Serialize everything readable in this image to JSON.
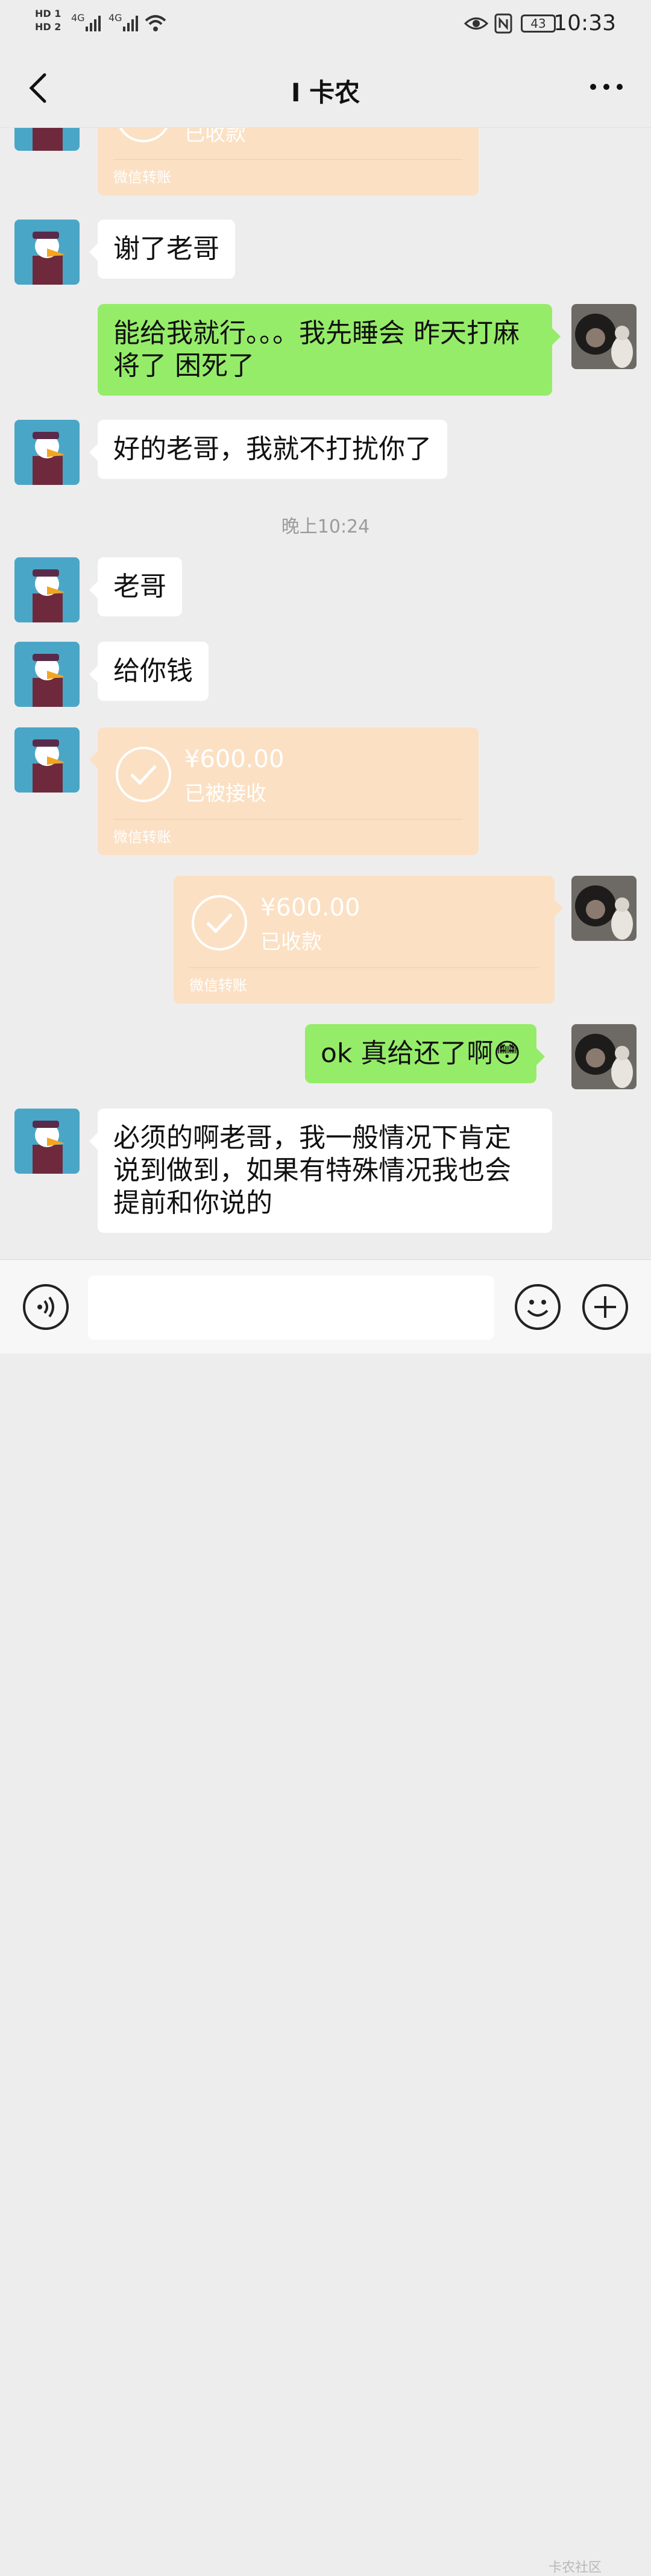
{
  "status_bar": {
    "sim1": "HD 1",
    "sim2": "HD 2",
    "net1": "4G",
    "net2": "4G",
    "battery": "43",
    "time": "10:33"
  },
  "header": {
    "title": "I 卡农"
  },
  "messages": {
    "m0": {
      "status": "已收款",
      "footer": "微信转账"
    },
    "m1": {
      "text": "谢了老哥"
    },
    "m2": {
      "text": "能给我就行。。。我先睡会  昨天打麻将了  困死了"
    },
    "m3": {
      "text": "好的老哥，我就不打扰你了"
    },
    "time1": "晚上10:24",
    "m4": {
      "text": "老哥"
    },
    "m5": {
      "text": "给你钱"
    },
    "m6": {
      "amount": "¥600.00",
      "status": "已被接收",
      "footer": "微信转账"
    },
    "m7": {
      "amount": "¥600.00",
      "status": "已收款",
      "footer": "微信转账"
    },
    "m8": {
      "text": "ok  真给还了啊😳"
    },
    "m9": {
      "text": "必须的啊老哥，我一般情况下肯定说到做到，如果有特殊情况我也会提前和你说的"
    }
  },
  "input": {
    "value": ""
  },
  "watermark": "卡农社区",
  "colors": {
    "sent_bubble": "#95ec69",
    "received_bubble": "#ffffff",
    "transfer_card": "#fbe0c3",
    "background": "#ededed"
  }
}
